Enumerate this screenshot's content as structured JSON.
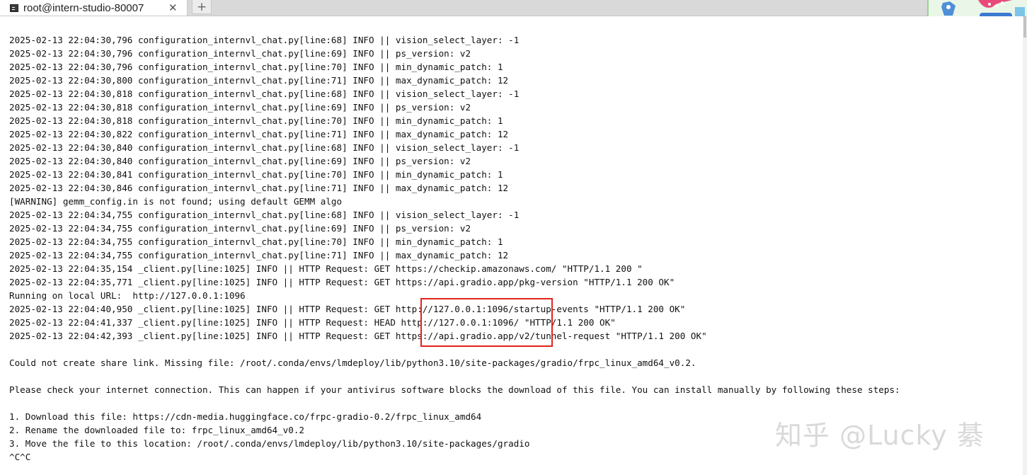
{
  "tab": {
    "title": "root@intern-studio-80007",
    "close_glyph": "✕",
    "new_tab_glyph": "+",
    "icon": "terminal-icon"
  },
  "colors": {
    "highlight_border": "#e2231a",
    "tab_bar_bg": "#d9d9d9",
    "text": "#111111"
  },
  "terminal": {
    "lines": [
      "2025-02-13 22:04:30,796 configuration_internvl_chat.py[line:68] INFO || vision_select_layer: -1",
      "2025-02-13 22:04:30,796 configuration_internvl_chat.py[line:69] INFO || ps_version: v2",
      "2025-02-13 22:04:30,796 configuration_internvl_chat.py[line:70] INFO || min_dynamic_patch: 1",
      "2025-02-13 22:04:30,800 configuration_internvl_chat.py[line:71] INFO || max_dynamic_patch: 12",
      "2025-02-13 22:04:30,818 configuration_internvl_chat.py[line:68] INFO || vision_select_layer: -1",
      "2025-02-13 22:04:30,818 configuration_internvl_chat.py[line:69] INFO || ps_version: v2",
      "2025-02-13 22:04:30,818 configuration_internvl_chat.py[line:70] INFO || min_dynamic_patch: 1",
      "2025-02-13 22:04:30,822 configuration_internvl_chat.py[line:71] INFO || max_dynamic_patch: 12",
      "2025-02-13 22:04:30,840 configuration_internvl_chat.py[line:68] INFO || vision_select_layer: -1",
      "2025-02-13 22:04:30,840 configuration_internvl_chat.py[line:69] INFO || ps_version: v2",
      "2025-02-13 22:04:30,841 configuration_internvl_chat.py[line:70] INFO || min_dynamic_patch: 1",
      "2025-02-13 22:04:30,846 configuration_internvl_chat.py[line:71] INFO || max_dynamic_patch: 12",
      "[WARNING] gemm_config.in is not found; using default GEMM algo",
      "2025-02-13 22:04:34,755 configuration_internvl_chat.py[line:68] INFO || vision_select_layer: -1",
      "2025-02-13 22:04:34,755 configuration_internvl_chat.py[line:69] INFO || ps_version: v2",
      "2025-02-13 22:04:34,755 configuration_internvl_chat.py[line:70] INFO || min_dynamic_patch: 1",
      "2025-02-13 22:04:34,755 configuration_internvl_chat.py[line:71] INFO || max_dynamic_patch: 12",
      "2025-02-13 22:04:35,154 _client.py[line:1025] INFO || HTTP Request: GET https://checkip.amazonaws.com/ \"HTTP/1.1 200 \"",
      "2025-02-13 22:04:35,771 _client.py[line:1025] INFO || HTTP Request: GET https://api.gradio.app/pkg-version \"HTTP/1.1 200 OK\"",
      "Running on local URL:  http://127.0.0.1:1096",
      "2025-02-13 22:04:40,950 _client.py[line:1025] INFO || HTTP Request: GET http://127.0.0.1:1096/startup-events \"HTTP/1.1 200 OK\"",
      "2025-02-13 22:04:41,337 _client.py[line:1025] INFO || HTTP Request: HEAD http://127.0.0.1:1096/ \"HTTP/1.1 200 OK\"",
      "2025-02-13 22:04:42,393 _client.py[line:1025] INFO || HTTP Request: GET https://api.gradio.app/v2/tunnel-request \"HTTP/1.1 200 OK\"",
      "",
      "Could not create share link. Missing file: /root/.conda/envs/lmdeploy/lib/python3.10/site-packages/gradio/frpc_linux_amd64_v0.2.",
      "",
      "Please check your internet connection. This can happen if your antivirus software blocks the download of this file. You can install manually by following these steps:",
      "",
      "1. Download this file: https://cdn-media.huggingface.co/frpc-gradio-0.2/frpc_linux_amd64",
      "2. Rename the downloaded file to: frpc_linux_amd64_v0.2",
      "3. Move the file to this location: /root/.conda/envs/lmdeploy/lib/python3.10/site-packages/gradio",
      "^C^C"
    ]
  },
  "watermark": {
    "text": "知乎 @Lucky 綦"
  },
  "sticker": {
    "icon": "cartoon-sticker-icon"
  }
}
